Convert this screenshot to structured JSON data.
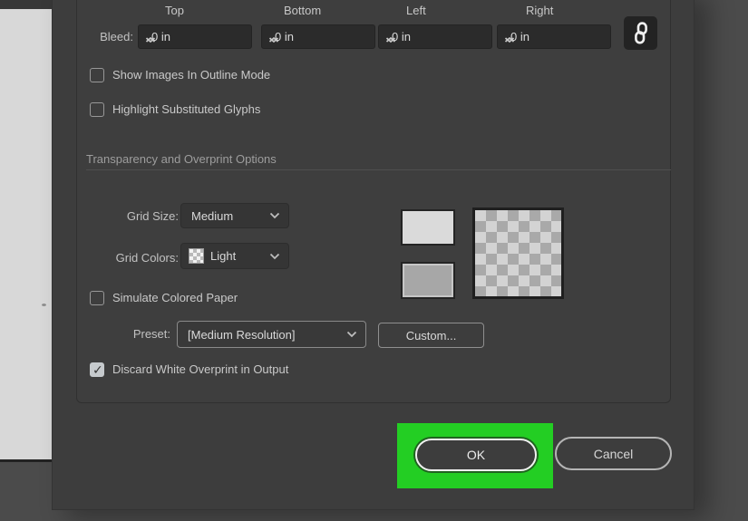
{
  "bleed_row": {
    "label": "Bleed:",
    "column_labels": [
      "Top",
      "Bottom",
      "Left",
      "Right"
    ],
    "fields": [
      {
        "id": "top",
        "value": "0 in"
      },
      {
        "id": "bottom",
        "value": "0 in"
      },
      {
        "id": "left",
        "value": "0 in"
      },
      {
        "id": "right",
        "value": "0 in"
      }
    ]
  },
  "view_options": [
    {
      "label": "Show Images In Outline Mode",
      "checked": false
    },
    {
      "label": "Highlight Substituted Glyphs",
      "checked": false
    }
  ],
  "transparency_section": {
    "title": "Transparency and Overprint Options",
    "grid_size": {
      "label": "Grid Size:",
      "selected": "Medium"
    },
    "grid_colors": {
      "label": "Grid Colors:",
      "selected": "Light"
    },
    "simulate_colored_paper": {
      "label": "Simulate Colored Paper",
      "checked": false
    },
    "preset": {
      "label": "Preset:",
      "selected": "[Medium Resolution]"
    },
    "custom_button_label": "Custom...",
    "discard_white_overprint": {
      "label": "Discard White Overprint in Output",
      "checked": true
    }
  },
  "transparency_preview": {
    "solid_swatch_colors": [
      "#dadada",
      "#a7a7a7"
    ],
    "checker_colors": [
      "#d3d3d3",
      "#a9a9a9"
    ]
  },
  "footer_buttons": {
    "ok": "OK",
    "cancel": "Cancel"
  },
  "annotation": {
    "highlighted_button": "OK",
    "highlight_color": "#23ce23"
  },
  "icons": {
    "bleed_link": "chain-link-icon",
    "dropdown": "chevron-down-icon",
    "stepper": "up-down-arrows-icon",
    "grid_colors_swatch": "checkerboard-icon"
  }
}
